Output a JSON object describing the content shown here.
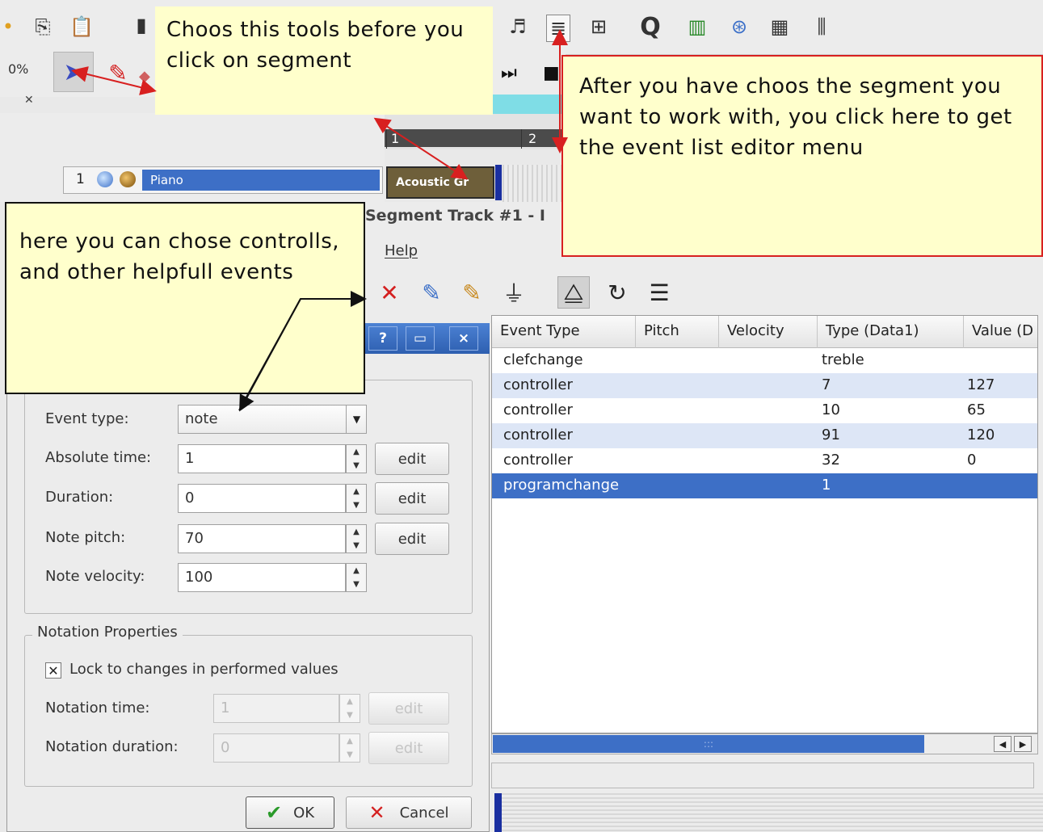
{
  "app": {
    "zoom_readout": "0%",
    "editor_title": "Segment Track #1 - I",
    "menu_help": "Help",
    "ruler_numbers": [
      "1",
      "2"
    ],
    "track": {
      "number": "1",
      "name": "Piano"
    },
    "segment_label": "Acoustic Gr"
  },
  "callouts": {
    "tools": "Choos this tools before you click on segment",
    "editor": "After you have choos the segment you want to work with, you click here to get the event list editor menu",
    "events": "here you can chose controlls, and other helpfull events"
  },
  "event_table": {
    "headers": [
      "Event Type",
      "Pitch",
      "Velocity",
      "Type (Data1)",
      "Value (D"
    ],
    "rows": [
      {
        "event_type": "clefchange",
        "pitch": "",
        "velocity": "",
        "type": "treble",
        "value": ""
      },
      {
        "event_type": "controller",
        "pitch": "",
        "velocity": "",
        "type": "7",
        "value": "127"
      },
      {
        "event_type": "controller",
        "pitch": "",
        "velocity": "",
        "type": "10",
        "value": "65"
      },
      {
        "event_type": "controller",
        "pitch": "",
        "velocity": "",
        "type": "91",
        "value": "120"
      },
      {
        "event_type": "controller",
        "pitch": "",
        "velocity": "",
        "type": "32",
        "value": "0"
      },
      {
        "event_type": "programchange",
        "pitch": "",
        "velocity": "",
        "type": "1",
        "value": ""
      }
    ],
    "scroll_grip": ":::",
    "selected_row": 5
  },
  "dialog": {
    "titlebar_buttons": [
      "?",
      "▭",
      "×"
    ],
    "event_type_label": "Event type:",
    "event_type_value": "note",
    "absolute_time_label": "Absolute time:",
    "absolute_time_value": "1",
    "duration_label": "Duration:",
    "duration_value": "0",
    "note_pitch_label": "Note pitch:",
    "note_pitch_value": "70",
    "note_velocity_label": "Note velocity:",
    "note_velocity_value": "100",
    "edit_label": "edit",
    "notation_group_title": "Notation Properties",
    "lock_label": "Lock to changes in performed values",
    "lock_checked": true,
    "notation_time_label": "Notation time:",
    "notation_time_value": "1",
    "notation_duration_label": "Notation duration:",
    "notation_duration_value": "0",
    "ok_label": "OK",
    "cancel_label": "Cancel"
  },
  "colors": {
    "callout_bg": "#ffffcc",
    "selection": "#3d6fc6",
    "alt_row": "#dde6f6",
    "arrow_red": "#d82020"
  }
}
